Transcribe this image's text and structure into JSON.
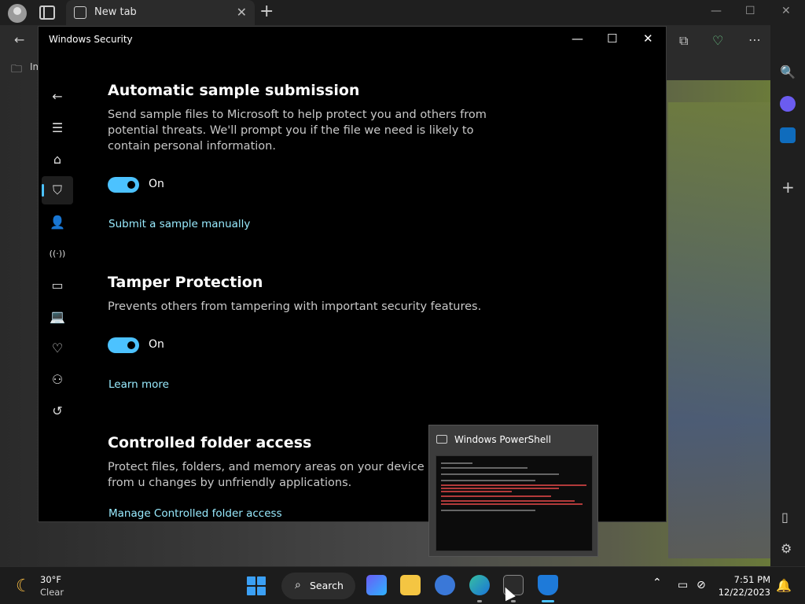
{
  "browser": {
    "tab_title": "New tab",
    "close_glyph": "✕",
    "new_tab_glyph": "+",
    "fav_truncated": "Im",
    "icons": [
      "profile-icon",
      "tab-actions-icon",
      "back-arrow-icon",
      "collections-icon",
      "health-icon",
      "more-icon",
      "copilot-icon",
      "favorites-folder-icon"
    ]
  },
  "window": {
    "title": "Windows Security",
    "controls": {
      "minimize": "—",
      "maximize": "☐",
      "close": "✕"
    }
  },
  "nav": {
    "items": [
      {
        "name": "back",
        "glyph": "←"
      },
      {
        "name": "menu",
        "glyph": "☰"
      },
      {
        "name": "home",
        "glyph": "⌂"
      },
      {
        "name": "virus-protection",
        "glyph": "⛉"
      },
      {
        "name": "account-protection",
        "glyph": "👤"
      },
      {
        "name": "firewall",
        "glyph": "((·))"
      },
      {
        "name": "app-browser-control",
        "glyph": "▭"
      },
      {
        "name": "device-security",
        "glyph": "💻"
      },
      {
        "name": "device-performance",
        "glyph": "♡"
      },
      {
        "name": "family-options",
        "glyph": "⚇"
      },
      {
        "name": "protection-history",
        "glyph": "↺"
      },
      {
        "name": "settings",
        "glyph": "⚙"
      }
    ]
  },
  "sections": [
    {
      "title": "Automatic sample submission",
      "description": "Send sample files to Microsoft to help protect you and others from potential threats. We'll prompt you if the file we need is likely to contain personal information.",
      "toggle_state": "On",
      "link": "Submit a sample manually"
    },
    {
      "title": "Tamper Protection",
      "description": "Prevents others from tampering with important security features.",
      "toggle_state": "On",
      "link": "Learn more"
    },
    {
      "title": "Controlled folder access",
      "description": "Protect files, folders, and memory areas on your device from u changes by unfriendly applications.",
      "link": "Manage Controlled folder access"
    }
  ],
  "powershell_preview": {
    "title": "Windows PowerShell"
  },
  "taskbar": {
    "weather_temp": "30°F",
    "weather_desc": "Clear",
    "search_label": "Search",
    "time": "7:51 PM",
    "date": "12/22/2023",
    "colors": {
      "accent": "#4cc2ff",
      "start": "#3ba0f5"
    }
  }
}
